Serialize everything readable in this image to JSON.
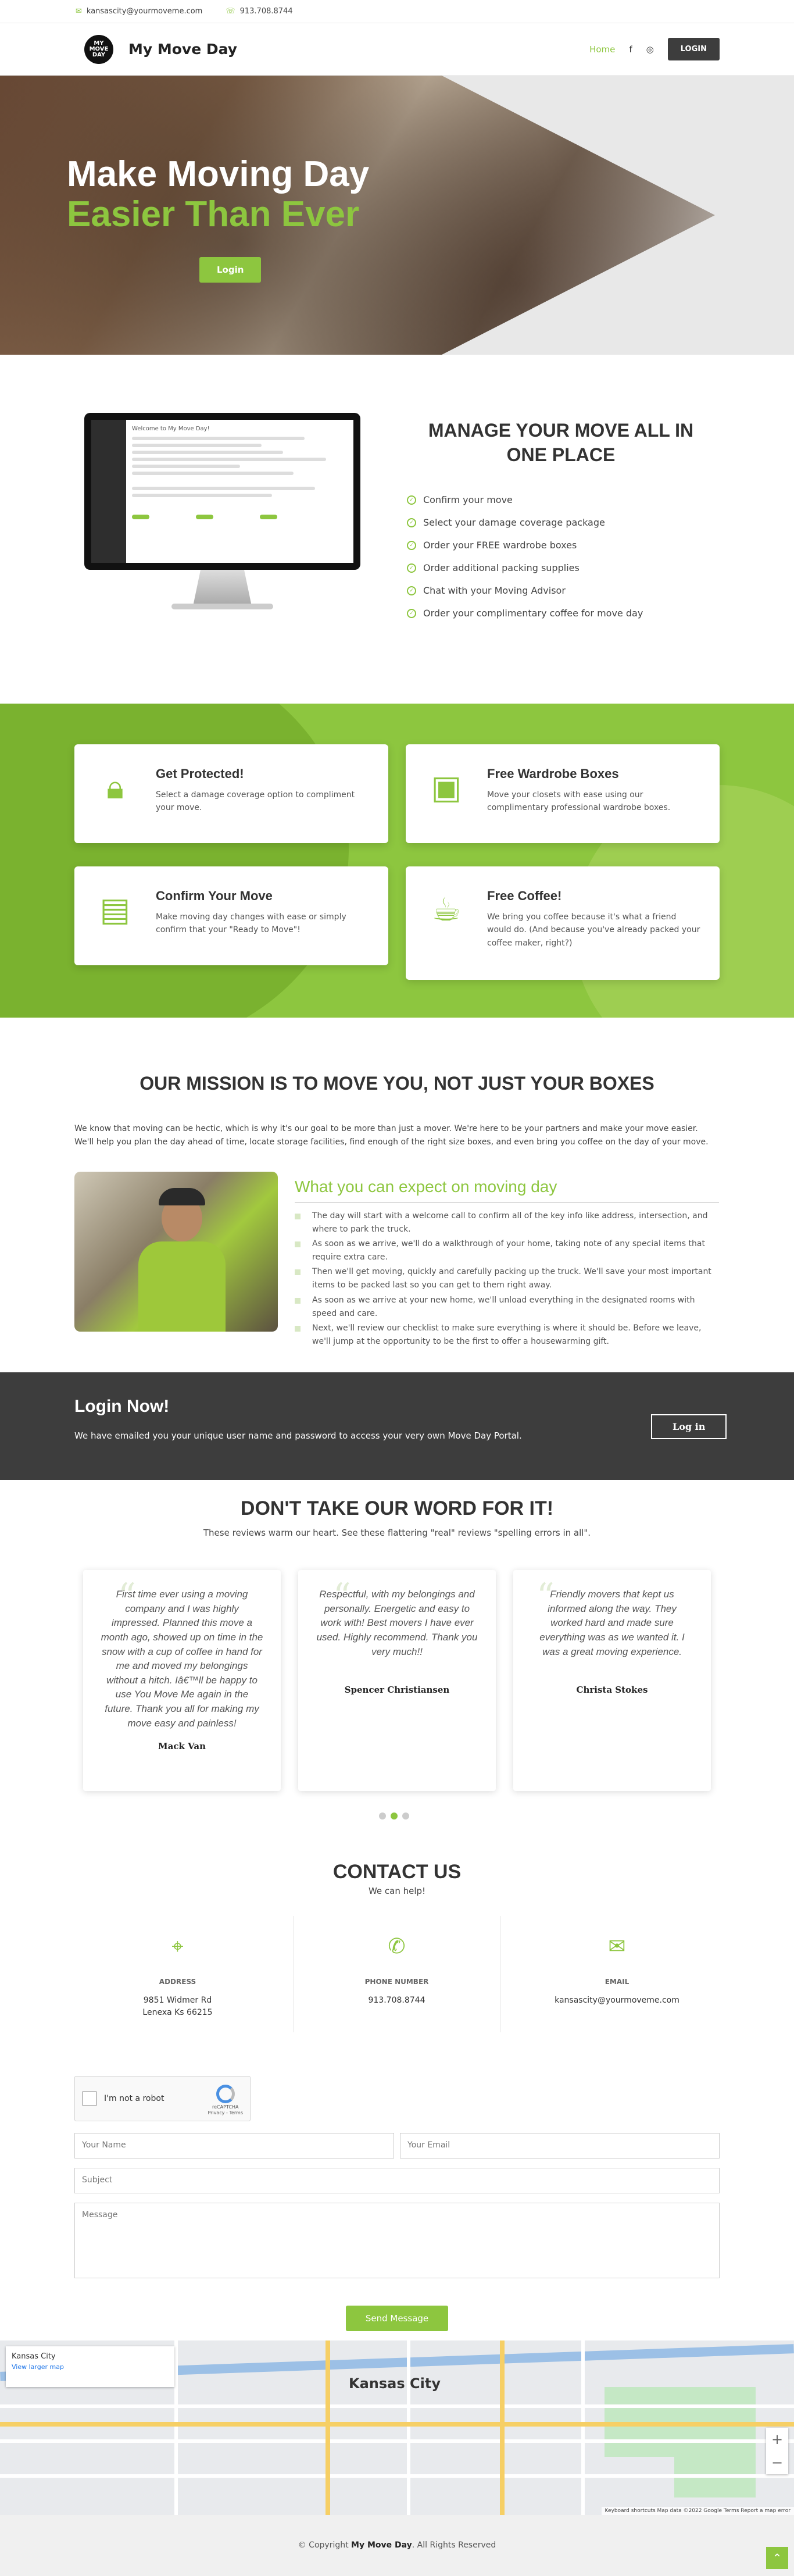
{
  "topbar": {
    "email": "kansascity@yourmoveme.com",
    "phone": "913.708.8744"
  },
  "header": {
    "brand": "My Move Day",
    "logo_text": "MY MOVE DAY",
    "nav": {
      "home": "Home",
      "login": "LOGIN"
    },
    "icons": [
      "facebook-icon",
      "instagram-icon"
    ]
  },
  "hero": {
    "title_line1": "Make Moving Day",
    "title_line2": "Easier Than Ever",
    "button": "Login"
  },
  "manage": {
    "title": "MANAGE YOUR MOVE ALL IN ONE PLACE",
    "screen_title": "Welcome to My Move Day!",
    "items": [
      "Confirm your move",
      "Select your damage coverage package",
      "Order your FREE wardrobe boxes",
      "Order additional packing supplies",
      "Chat with your Moving Advisor",
      "Order your complimentary coffee for move day"
    ]
  },
  "features": [
    {
      "title": "Get Protected!",
      "text": "Select a damage coverage option to compliment your move.",
      "icon": "lock-icon"
    },
    {
      "title": "Free Wardrobe Boxes",
      "text": "Move your closets with ease using our complimentary professional wardrobe boxes.",
      "icon": "box-icon"
    },
    {
      "title": "Confirm Your Move",
      "text": "Make moving day changes with ease or simply confirm that your \"Ready to Move\"!",
      "icon": "document-icon"
    },
    {
      "title": "Free Coffee!",
      "text": "We bring you coffee because it's what a friend would do. (And because you've already packed your coffee maker, right?)",
      "icon": "coffee-icon"
    }
  ],
  "mission": {
    "title": "OUR MISSION IS TO MOVE YOU, NOT JUST YOUR BOXES",
    "intro": "We know that moving can be hectic, which is why it's our goal to be more than just a mover. We're here to be your partners and make your move easier. We'll help you plan the day ahead of time, locate storage facilities, find enough of the right size boxes, and even bring you coffee on the day of your move.",
    "expect_title": "What you can expect on moving day",
    "expect": [
      "The day will start with a welcome call to confirm all of the key info like address, intersection, and where to park the truck.",
      "As soon as we arrive, we'll do a walkthrough of your home, taking note of any special items that require extra care.",
      "Then we'll get moving, quickly and carefully packing up the truck. We'll save your most important items to be packed last so you can get to them right away.",
      "As soon as we arrive at your new home, we'll unload everything in the designated rooms with speed and care.",
      "Next, we'll review our checklist to make sure everything is where it should be. Before we leave, we'll jump at the opportunity to be the first to offer a housewarming gift."
    ]
  },
  "login_bar": {
    "title": "Login Now!",
    "text": "We have emailed you your unique user name and password to access your very own Move Day Portal.",
    "button": "Log in"
  },
  "reviews": {
    "title": "DON'T TAKE OUR WORD FOR IT!",
    "subtitle": "These reviews warm our heart. See these flattering \"real\" reviews \"spelling errors in all\".",
    "items": [
      {
        "text": "First time ever using a moving company and I was highly impressed. Planned this move a month ago, showed up on time in the snow with a cup of coffee in hand for me and moved my belongings without a hitch. Iâ€™ll be happy to use You Move Me again in the future. Thank you all for making my move easy and painless!",
        "name": "Mack Van"
      },
      {
        "text": "Respectful, with my belongings and personally. Energetic and easy to work with! Best movers I have ever used. Highly recommend. Thank you very much!!",
        "name": "Spencer Christiansen"
      },
      {
        "text": "Friendly movers that kept us informed along the way. They worked hard and made sure everything was as we wanted it. I was a great moving experience.",
        "name": "Christa Stokes"
      }
    ]
  },
  "contact": {
    "title": "CONTACT US",
    "subtitle": "We can help!",
    "address_label": "ADDRESS",
    "address_line1": "9851 Widmer Rd",
    "address_line2": "Lenexa Ks 66215",
    "phone_label": "PHONE NUMBER",
    "phone": "913.708.8744",
    "email_label": "EMAIL",
    "email": "kansascity@yourmoveme.com",
    "captcha": "I'm not a robot",
    "captcha_brand": "reCAPTCHA",
    "captcha_terms": "Privacy - Terms",
    "form": {
      "name": "Your Name",
      "email": "Your Email",
      "subject": "Subject",
      "message": "Message"
    },
    "send": "Send Message"
  },
  "map": {
    "place": "Kansas City",
    "link": "View larger map",
    "city": "Kansas City",
    "attribution": "Keyboard shortcuts   Map data ©2022 Google   Terms   Report a map error"
  },
  "footer": {
    "prefix": "© Copyright ",
    "brand": "My Move Day",
    "suffix": ". All Rights Reserved"
  },
  "colors": {
    "accent": "#8dc63f",
    "dark": "#3d3d3d"
  }
}
